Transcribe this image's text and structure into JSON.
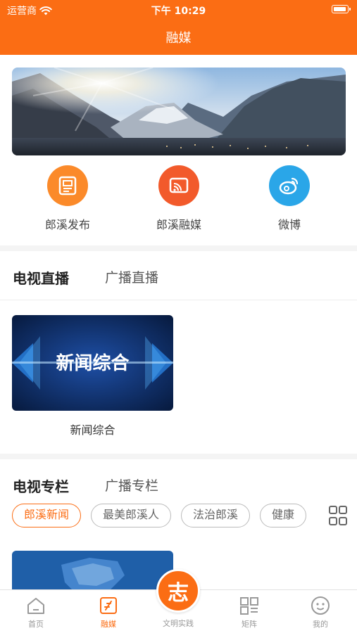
{
  "status_bar": {
    "carrier": "运营商",
    "time": "下午 10:29"
  },
  "nav": {
    "title": "融媒"
  },
  "quick_links": [
    {
      "label": "郎溪发布",
      "icon": "newspaper-icon",
      "color": "#fb8a2a"
    },
    {
      "label": "郎溪融媒",
      "icon": "cast-icon",
      "color": "#f25a2b"
    },
    {
      "label": "微博",
      "icon": "weibo-icon",
      "color": "#2aa6e8"
    }
  ],
  "live": {
    "tabs": [
      "电视直播",
      "广播直播"
    ],
    "active_tab": "电视直播",
    "channels": [
      {
        "title": "新闻综合",
        "thumb_text": "新闻综合"
      }
    ]
  },
  "columns": {
    "tabs": [
      "电视专栏",
      "广播专栏"
    ],
    "active_tab": "电视专栏",
    "chips": [
      "郎溪新闻",
      "最美郎溪人",
      "法治郎溪",
      "健康"
    ],
    "selected_chip": "郎溪新闻"
  },
  "tabbar": {
    "items": [
      {
        "label": "首页",
        "icon": "home-icon"
      },
      {
        "label": "融媒",
        "icon": "media-icon",
        "active": true
      },
      {
        "label": "文明实践",
        "icon": "volunteer-icon",
        "center_glyph": "志"
      },
      {
        "label": "矩阵",
        "icon": "matrix-icon"
      },
      {
        "label": "我的",
        "icon": "profile-icon"
      }
    ]
  },
  "colors": {
    "accent": "#fb6d14",
    "divider": "#f4f4f4"
  }
}
